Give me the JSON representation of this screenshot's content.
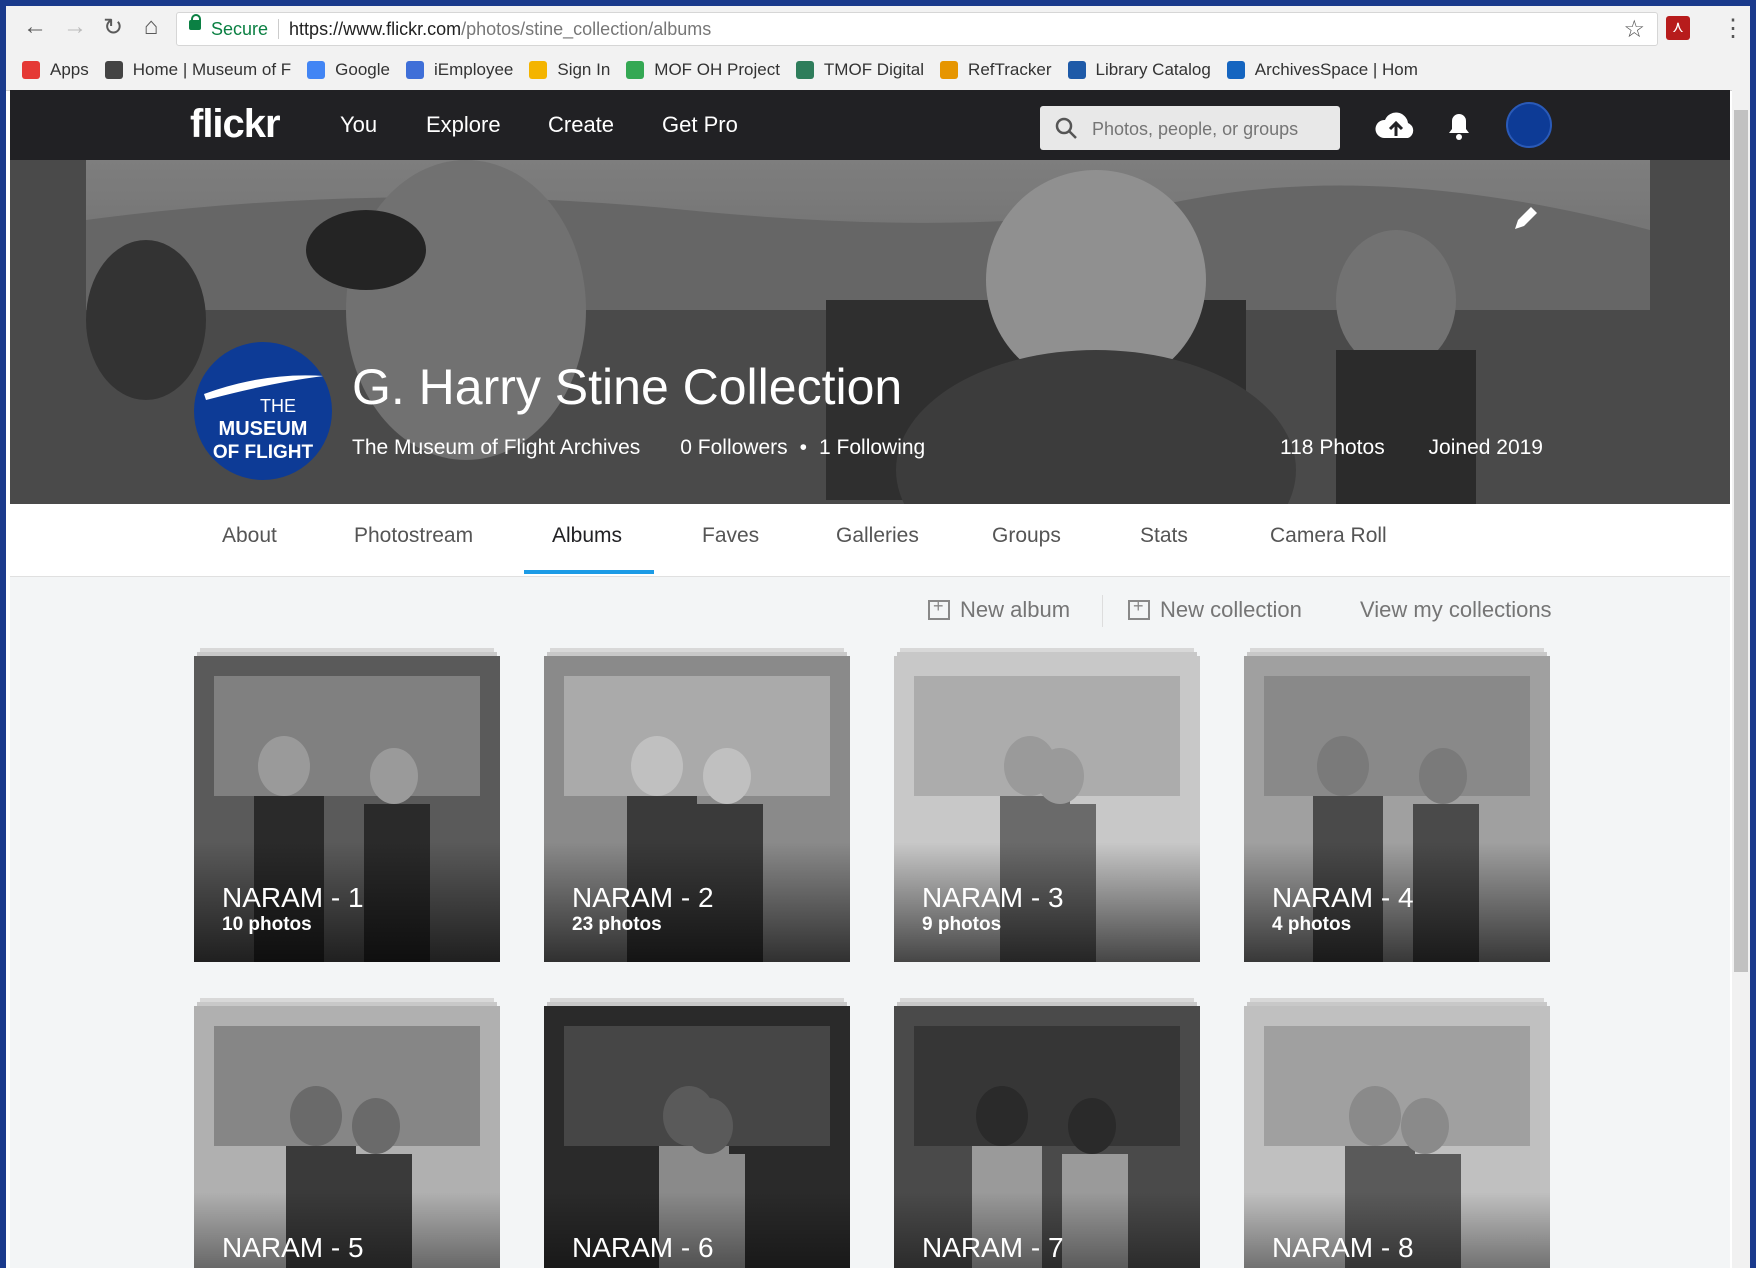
{
  "browser": {
    "secure_label": "Secure",
    "url_host": "https://www.flickr.com",
    "url_path": "/photos/stine_collection/albums",
    "bookmarks": [
      {
        "label": "Apps",
        "color": "#e53935"
      },
      {
        "label": "Home | Museum of F",
        "color": "#444444"
      },
      {
        "label": "Google",
        "color": "#4285f4"
      },
      {
        "label": "iEmployee",
        "color": "#3f6fd8"
      },
      {
        "label": "Sign In",
        "color": "#f4b400"
      },
      {
        "label": "MOF OH Project",
        "color": "#34a853"
      },
      {
        "label": "TMOF Digital",
        "color": "#2e7d5b"
      },
      {
        "label": "RefTracker",
        "color": "#e69500"
      },
      {
        "label": "Library Catalog",
        "color": "#1e5aa8"
      },
      {
        "label": "ArchivesSpace | Hom",
        "color": "#1565c0"
      }
    ]
  },
  "nav": {
    "logo": "flickr",
    "links": [
      "You",
      "Explore",
      "Create",
      "Get Pro"
    ],
    "search_placeholder": "Photos, people, or groups"
  },
  "profile": {
    "name": "G. Harry Stine Collection",
    "owner": "The Museum of Flight Archives",
    "followers": "0 Followers",
    "separator": "•",
    "following": "1 Following",
    "photos": "118 Photos",
    "joined": "Joined 2019",
    "avatar_lines": [
      "THE",
      "MUSEUM",
      "OF FLIGHT"
    ]
  },
  "tabs": [
    "About",
    "Photostream",
    "Albums",
    "Faves",
    "Galleries",
    "Groups",
    "Stats",
    "Camera Roll"
  ],
  "active_tab": "Albums",
  "actions": {
    "new_album": "New album",
    "new_collection": "New collection",
    "view_collections": "View my collections"
  },
  "albums": [
    {
      "title": "NARAM - 1",
      "count": "10 photos"
    },
    {
      "title": "NARAM - 2",
      "count": "23 photos"
    },
    {
      "title": "NARAM - 3",
      "count": "9 photos"
    },
    {
      "title": "NARAM - 4",
      "count": "4 photos"
    },
    {
      "title": "NARAM - 5",
      "count": ""
    },
    {
      "title": "NARAM - 6",
      "count": ""
    },
    {
      "title": "NARAM - 7",
      "count": ""
    },
    {
      "title": "NARAM - 8",
      "count": ""
    }
  ],
  "colors": {
    "accent": "#1c9be6",
    "nav_bg": "#212124",
    "avatar_blue": "#0d3b96"
  }
}
